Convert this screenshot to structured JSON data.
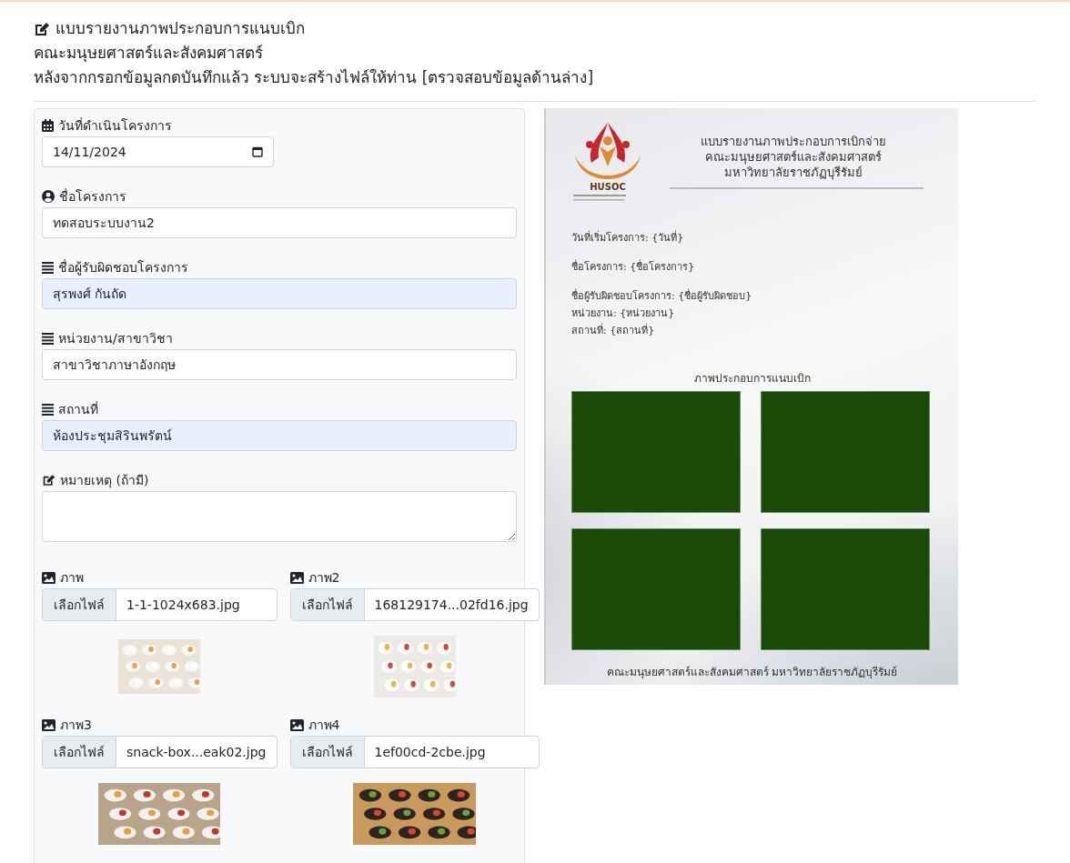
{
  "header": {
    "title": "แบบรายงานภาพประกอบการแนบเบิก",
    "faculty": "คณะมนุษยศาสตร์และสังคมศาสตร์",
    "instruction": "หลังจากกรอกข้อมูลกดบันทึกแล้ว ระบบจะสร้างไฟล์ให้ท่าน [ตรวจสอบข้อมูลด้านล่าง]"
  },
  "form": {
    "fields": [
      {
        "kind": "date",
        "label": "วันที่ดำเนินโครงการ",
        "value": "14/11/2024",
        "autofilled": false
      },
      {
        "kind": "person",
        "label": "ชื่อโครงการ",
        "value": "ทดสอบระบบงาน2",
        "autofilled": false
      },
      {
        "kind": "list",
        "label": "ชื่อผู้รับผิดชอบโครงการ",
        "value": "สุรพงศ์ กันถัด",
        "autofilled": true
      },
      {
        "kind": "list",
        "label": "หน่วยงาน/สาขาวิชา",
        "value": "สาขาวิชาภาษาอังกฤษ",
        "autofilled": false
      },
      {
        "kind": "list",
        "label": "สถานที่",
        "value": "ห้องประชุมสิรินพรัตน์",
        "autofilled": true
      },
      {
        "kind": "note",
        "label": "หมายเหตุ (ถ้ามี)"
      }
    ],
    "uploads": [
      {
        "label": "ภาพ",
        "button": "เลือกไฟล์",
        "filename": "1-1-1024x683.jpg"
      },
      {
        "label": "ภาพ2",
        "button": "เลือกไฟล์",
        "filename": "168129174...02fd16.jpg"
      },
      {
        "label": "ภาพ3",
        "button": "เลือกไฟล์",
        "filename": "snack-box...eak02.jpg"
      },
      {
        "label": "ภาพ4",
        "button": "เลือกไฟล์",
        "filename": "1ef00cd-2cbe.jpg"
      }
    ]
  },
  "preview": {
    "logo_text": "HUSOC",
    "title_lines": [
      "แบบรายงานภาพประกอบการเบิกจ่าย",
      "คณะมนุษยศาสตร์และสังคมศาสตร์",
      "มหาวิทยาลัยราชภัฏบุรีรัมย์"
    ],
    "field_groups": [
      [
        "วันที่เริ่มโครงการ: {วันที่}"
      ],
      [
        "ชื่อโครงการ: {ชื่อโครงการ}"
      ],
      [
        "ชื่อผู้รับผิดชอบโครงการ: {ชื่อผู้รับผิดชอบ}",
        "หน่วยงาน: {หน่วยงาน}",
        "สถานที่: {สถานที่}"
      ]
    ],
    "photos_heading": "ภาพประกอบการแนบเบิก",
    "photo_slots": [
      {
        "kind": "placeholder"
      },
      {
        "kind": "placeholder"
      },
      {
        "kind": "placeholder"
      },
      {
        "kind": "placeholder"
      }
    ],
    "footer": "คณะมนุษยศาสตร์และสังคมศาสตร์ มหาวิทยาลัยราชภัฏบุรีรัมย์"
  }
}
